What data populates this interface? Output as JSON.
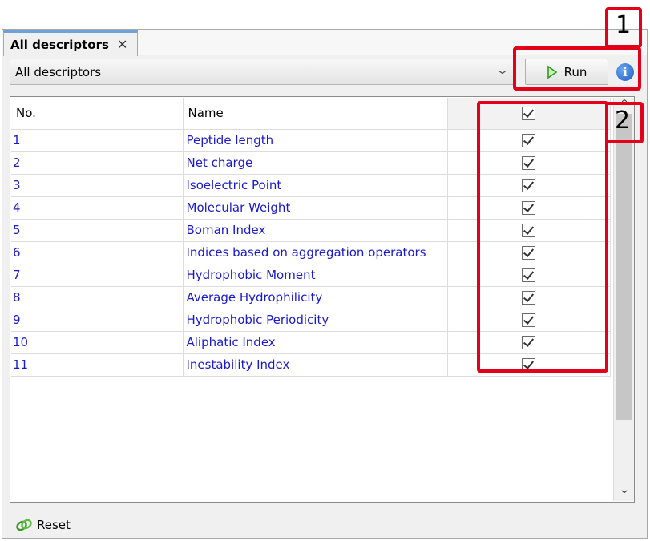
{
  "tab": {
    "title": "All descriptors",
    "close": "✕"
  },
  "toolbar": {
    "selected": "All descriptors",
    "run_label": "Run",
    "info_glyph": "i"
  },
  "table": {
    "columns": [
      "No.",
      "Name"
    ],
    "rows": [
      {
        "no": "1",
        "name": "Peptide length"
      },
      {
        "no": "2",
        "name": "Net charge"
      },
      {
        "no": "3",
        "name": "Isoelectric Point"
      },
      {
        "no": "4",
        "name": "Molecular Weight"
      },
      {
        "no": "5",
        "name": "Boman Index"
      },
      {
        "no": "6",
        "name": "Indices based on aggregation operators"
      },
      {
        "no": "7",
        "name": "Hydrophobic Moment"
      },
      {
        "no": "8",
        "name": "Average Hydrophilicity"
      },
      {
        "no": "9",
        "name": "Hydrophobic Periodicity"
      },
      {
        "no": "10",
        "name": "Aliphatic Index"
      },
      {
        "no": "11",
        "name": "Inestability Index"
      }
    ],
    "link_color": "#1a1acd"
  },
  "footer": {
    "reset_label": "Reset"
  },
  "annotations": {
    "one": "1",
    "two": "2",
    "color": "#e3001b"
  }
}
